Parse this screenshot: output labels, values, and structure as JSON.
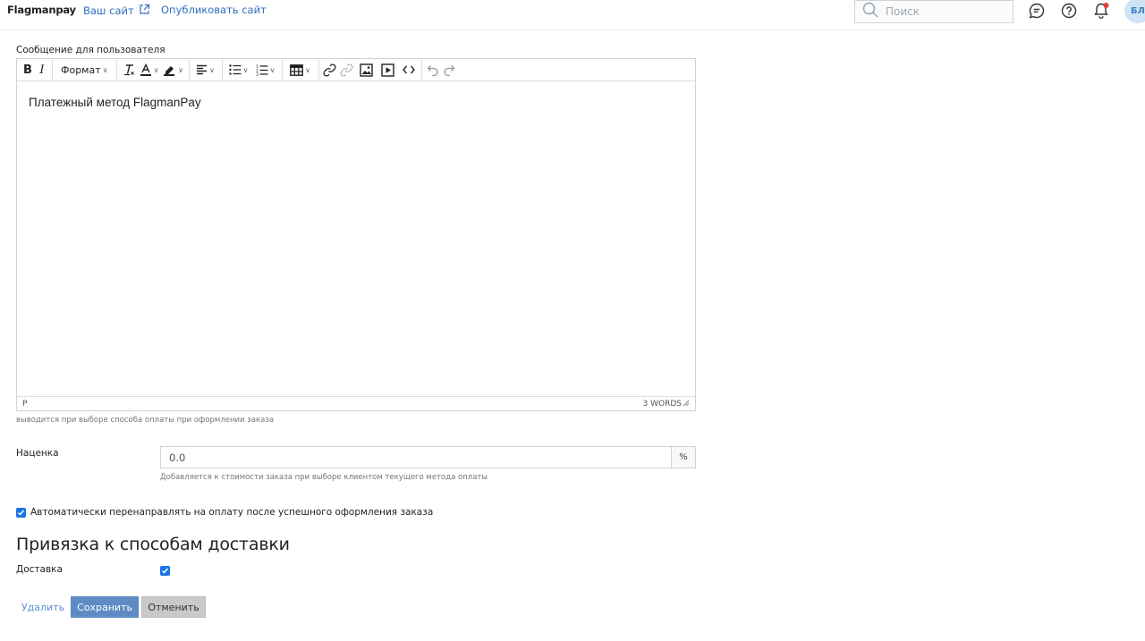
{
  "topbar": {
    "brand": "Flagmanpay",
    "site_link": "Ваш сайт",
    "publish_link": "Опубликовать сайт",
    "search_placeholder": "Поиск",
    "avatar_initials": "БЛ",
    "notification_color": "#e53935"
  },
  "message": {
    "label": "Сообщение для пользователя",
    "toolbar": {
      "bold": "B",
      "italic": "I",
      "format": "Формат"
    },
    "content": "Платежный метод FlagmanPay",
    "status_path": "P",
    "word_count": "3 WORDS",
    "hint": "выводится при выборе способа оплаты при оформлении заказа"
  },
  "markup": {
    "label": "Наценка",
    "value": "0.0",
    "unit": "%",
    "hint": "Добавляется к стоимости заказа при выборе клиентом текущего метода оплаты"
  },
  "auto_redirect": {
    "label": "Автоматически перенаправлять на оплату после успешного оформления заказа",
    "checked": true
  },
  "delivery_binding": {
    "title": "Привязка к способам доставки",
    "items": [
      {
        "label": "Доставка",
        "checked": true
      }
    ]
  },
  "actions": {
    "delete": "Удалить",
    "save": "Сохранить",
    "cancel": "Отменить"
  },
  "colors": {
    "link": "#2f6fbf",
    "primary_button": "#5f8bc4",
    "checkbox": "#1a73e8"
  }
}
